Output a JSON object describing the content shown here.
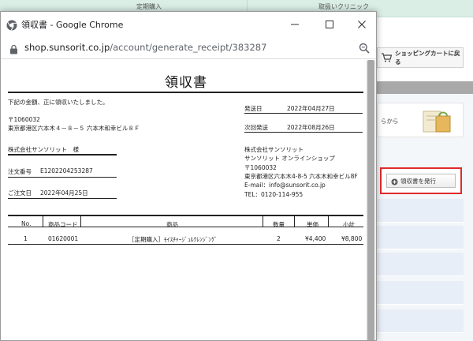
{
  "background": {
    "nav": [
      "定期購入",
      "取扱いクリニック"
    ],
    "cart_button": "ショッピングカートに戻る",
    "card_text": "らから",
    "receipt_button": "領収書を発行"
  },
  "window": {
    "title": "領収書 - Google Chrome",
    "url_host": "shop.sunsorit.co.jp",
    "url_path": "/account/generate_receipt/383287"
  },
  "receipt": {
    "title": "領収書",
    "intro": "下記の金額、正に領収いたしました。",
    "postal": "〒1060032",
    "address": "東京都港区六本木４－８－５ 六本木和幸ビル８Ｆ",
    "customer": "株式会社サンソリット　様",
    "order_no_label": "注文番号",
    "order_no": "E1202204253287",
    "order_date_label": "ご注文日",
    "order_date": "2022年04月25日",
    "ship_date_label": "発送日",
    "ship_date": "2022年04月27日",
    "next_ship_label": "次回発送",
    "next_ship": "2022年08月26日",
    "company": {
      "name": "株式会社サンソリット",
      "shop": "サンソリット オンラインショップ",
      "postal": "〒1060032",
      "address": "東京都港区六本木4-8-5 六本木和幸ビル8F",
      "email": "E-mail：info@sunsorit.co.jp",
      "tel": "TEL：0120-114-955"
    },
    "table": {
      "headers": [
        "No.",
        "商品コード",
        "商品",
        "数量",
        "単価",
        "小計"
      ],
      "rows": [
        {
          "no": "1",
          "code": "01620001",
          "item": "［定期購入］ﾓｲｽﾁｬｰｼﾞｭﾙｸﾚﾝｼﾞﾝｸﾞ",
          "qty": "2",
          "price": "¥4,400",
          "subtotal": "¥8,800"
        }
      ]
    }
  },
  "colors": {
    "highlight": "#e02b2b",
    "nav_bg": "#daeee6",
    "scrollbar": "#a8a8a8"
  }
}
